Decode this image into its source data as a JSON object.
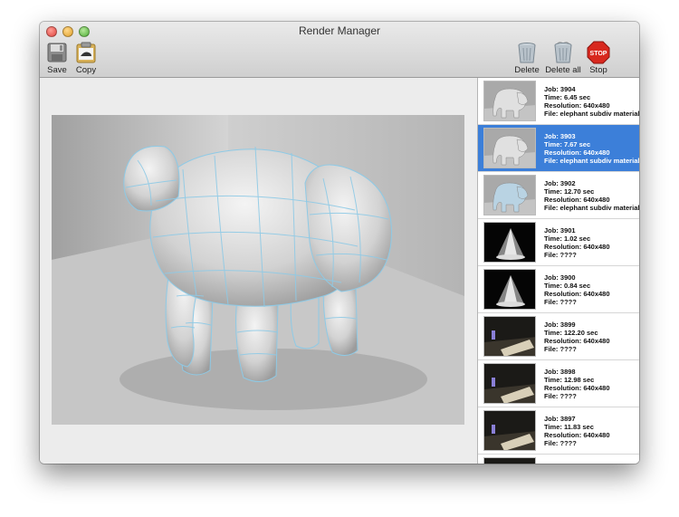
{
  "window": {
    "title": "Render Manager"
  },
  "toolbar": {
    "save_label": "Save",
    "copy_label": "Copy",
    "delete_label": "Delete",
    "delete_all_label": "Delete all",
    "stop_label": "Stop",
    "stop_sign_text": "STOP"
  },
  "jobs": [
    {
      "job": "Job: 3904",
      "time": "Time: 6.45 sec",
      "resolution": "Resolution: 640x480",
      "file": "File: elephant subdiv material",
      "thumb": "elephant",
      "selected": false
    },
    {
      "job": "Job: 3903",
      "time": "Time: 7.67 sec",
      "resolution": "Resolution: 640x480",
      "file": "File: elephant subdiv material",
      "thumb": "elephant",
      "selected": true
    },
    {
      "job": "Job: 3902",
      "time": "Time: 12.70 sec",
      "resolution": "Resolution: 640x480",
      "file": "File: elephant subdiv material",
      "thumb": "elephant-blue",
      "selected": false
    },
    {
      "job": "Job: 3901",
      "time": "Time: 1.02 sec",
      "resolution": "Resolution: 640x480",
      "file": "File: ????",
      "thumb": "spotlight",
      "selected": false
    },
    {
      "job": "Job: 3900",
      "time": "Time: 0.84 sec",
      "resolution": "Resolution: 640x480",
      "file": "File: ????",
      "thumb": "spotlight",
      "selected": false
    },
    {
      "job": "Job: 3899",
      "time": "Time: 122.20 sec",
      "resolution": "Resolution: 640x480",
      "file": "File: ????",
      "thumb": "room",
      "selected": false
    },
    {
      "job": "Job: 3898",
      "time": "Time: 12.98 sec",
      "resolution": "Resolution: 640x480",
      "file": "File: ????",
      "thumb": "room",
      "selected": false
    },
    {
      "job": "Job: 3897",
      "time": "Time: 11.83 sec",
      "resolution": "Resolution: 640x480",
      "file": "File: ????",
      "thumb": "room",
      "selected": false
    }
  ],
  "colors": {
    "selection": "#3c7fd9",
    "wireframe": "#8ecae6"
  }
}
